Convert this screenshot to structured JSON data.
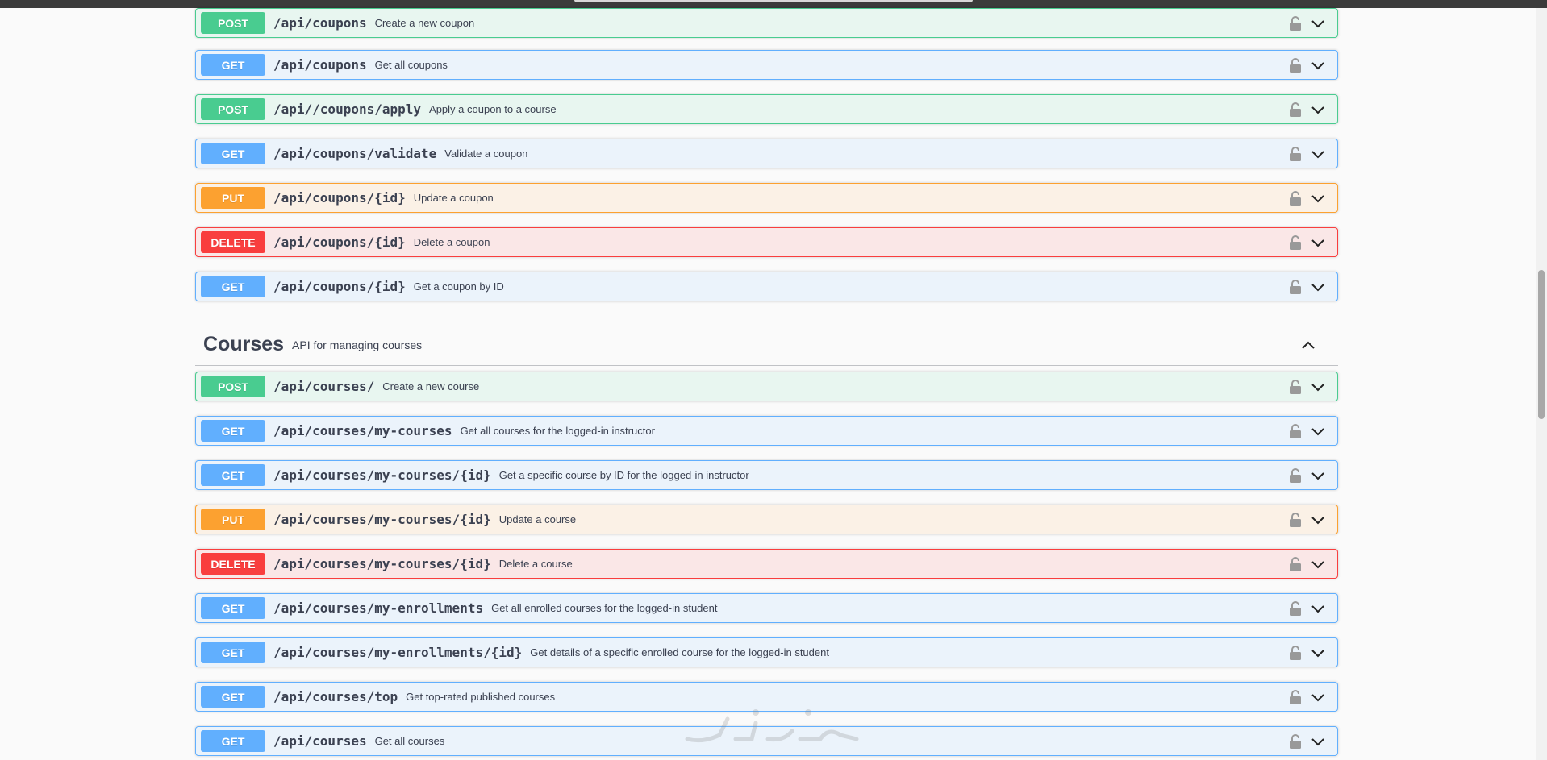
{
  "coupons_ops": [
    {
      "method": "POST",
      "path": "/api/coupons",
      "summary": "Create a new coupon"
    },
    {
      "method": "GET",
      "path": "/api/coupons",
      "summary": "Get all coupons"
    },
    {
      "method": "POST",
      "path": "/api//coupons/apply",
      "summary": "Apply a coupon to a course"
    },
    {
      "method": "GET",
      "path": "/api/coupons/validate",
      "summary": "Validate a coupon"
    },
    {
      "method": "PUT",
      "path": "/api/coupons/{id}",
      "summary": "Update a coupon"
    },
    {
      "method": "DELETE",
      "path": "/api/coupons/{id}",
      "summary": "Delete a coupon"
    },
    {
      "method": "GET",
      "path": "/api/coupons/{id}",
      "summary": "Get a coupon by ID"
    }
  ],
  "courses_tag": {
    "title": "Courses",
    "description": "API for managing courses"
  },
  "courses_ops": [
    {
      "method": "POST",
      "path": "/api/courses/",
      "summary": "Create a new course"
    },
    {
      "method": "GET",
      "path": "/api/courses/my-courses",
      "summary": "Get all courses for the logged-in instructor"
    },
    {
      "method": "GET",
      "path": "/api/courses/my-courses/{id}",
      "summary": "Get a specific course by ID for the logged-in instructor"
    },
    {
      "method": "PUT",
      "path": "/api/courses/my-courses/{id}",
      "summary": "Update a course"
    },
    {
      "method": "DELETE",
      "path": "/api/courses/my-courses/{id}",
      "summary": "Delete a course"
    },
    {
      "method": "GET",
      "path": "/api/courses/my-enrollments",
      "summary": "Get all enrolled courses for the logged-in student"
    },
    {
      "method": "GET",
      "path": "/api/courses/my-enrollments/{id}",
      "summary": "Get details of a specific enrolled course for the logged-in student"
    },
    {
      "method": "GET",
      "path": "/api/courses/top",
      "summary": "Get top-rated published courses"
    },
    {
      "method": "GET",
      "path": "/api/courses",
      "summary": "Get all courses"
    }
  ],
  "colors": {
    "post": "#49cc90",
    "get": "#61affe",
    "put": "#fca130",
    "delete": "#f93e3e"
  },
  "icons": {
    "lock": "unlocked-padlock-icon",
    "expand": "chevron-down-icon",
    "collapse": "chevron-up-icon"
  }
}
